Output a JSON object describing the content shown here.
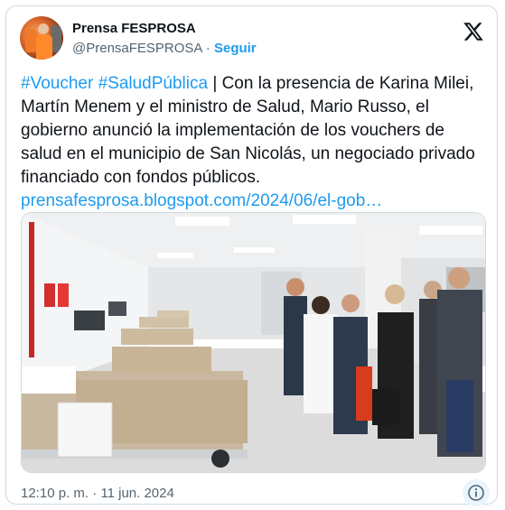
{
  "tweet": {
    "author_name": "Prensa FESPROSA",
    "handle": "@PrensaFESPROSA",
    "separator": " · ",
    "follow_label": "Seguir",
    "hashtag_1": "#Voucher",
    "hashtag_2": "#SaludPública",
    "divider": " | ",
    "body_text": "Con la presencia de Karina Milei, Martín Menem y el ministro de Salud, Mario Russo, el gobierno anunció la implementación de los vouchers de salud en el municipio de San Nicolás, un negociado privado financiado con fondos públicos.",
    "link_text": "prensafesprosa.blogspot.com/2024/06/el-gob…",
    "timestamp": "12:10 p. m. · 11 jun. 2024"
  },
  "icons": {
    "brand": "x-logo-icon",
    "info": "info-icon",
    "avatar": "avatar-image",
    "media": "hospital-ward-photo"
  },
  "colors": {
    "link": "#1d9bf0",
    "secondary_text": "#536471",
    "border": "#cfd9de",
    "primary_text": "#0f1419"
  }
}
